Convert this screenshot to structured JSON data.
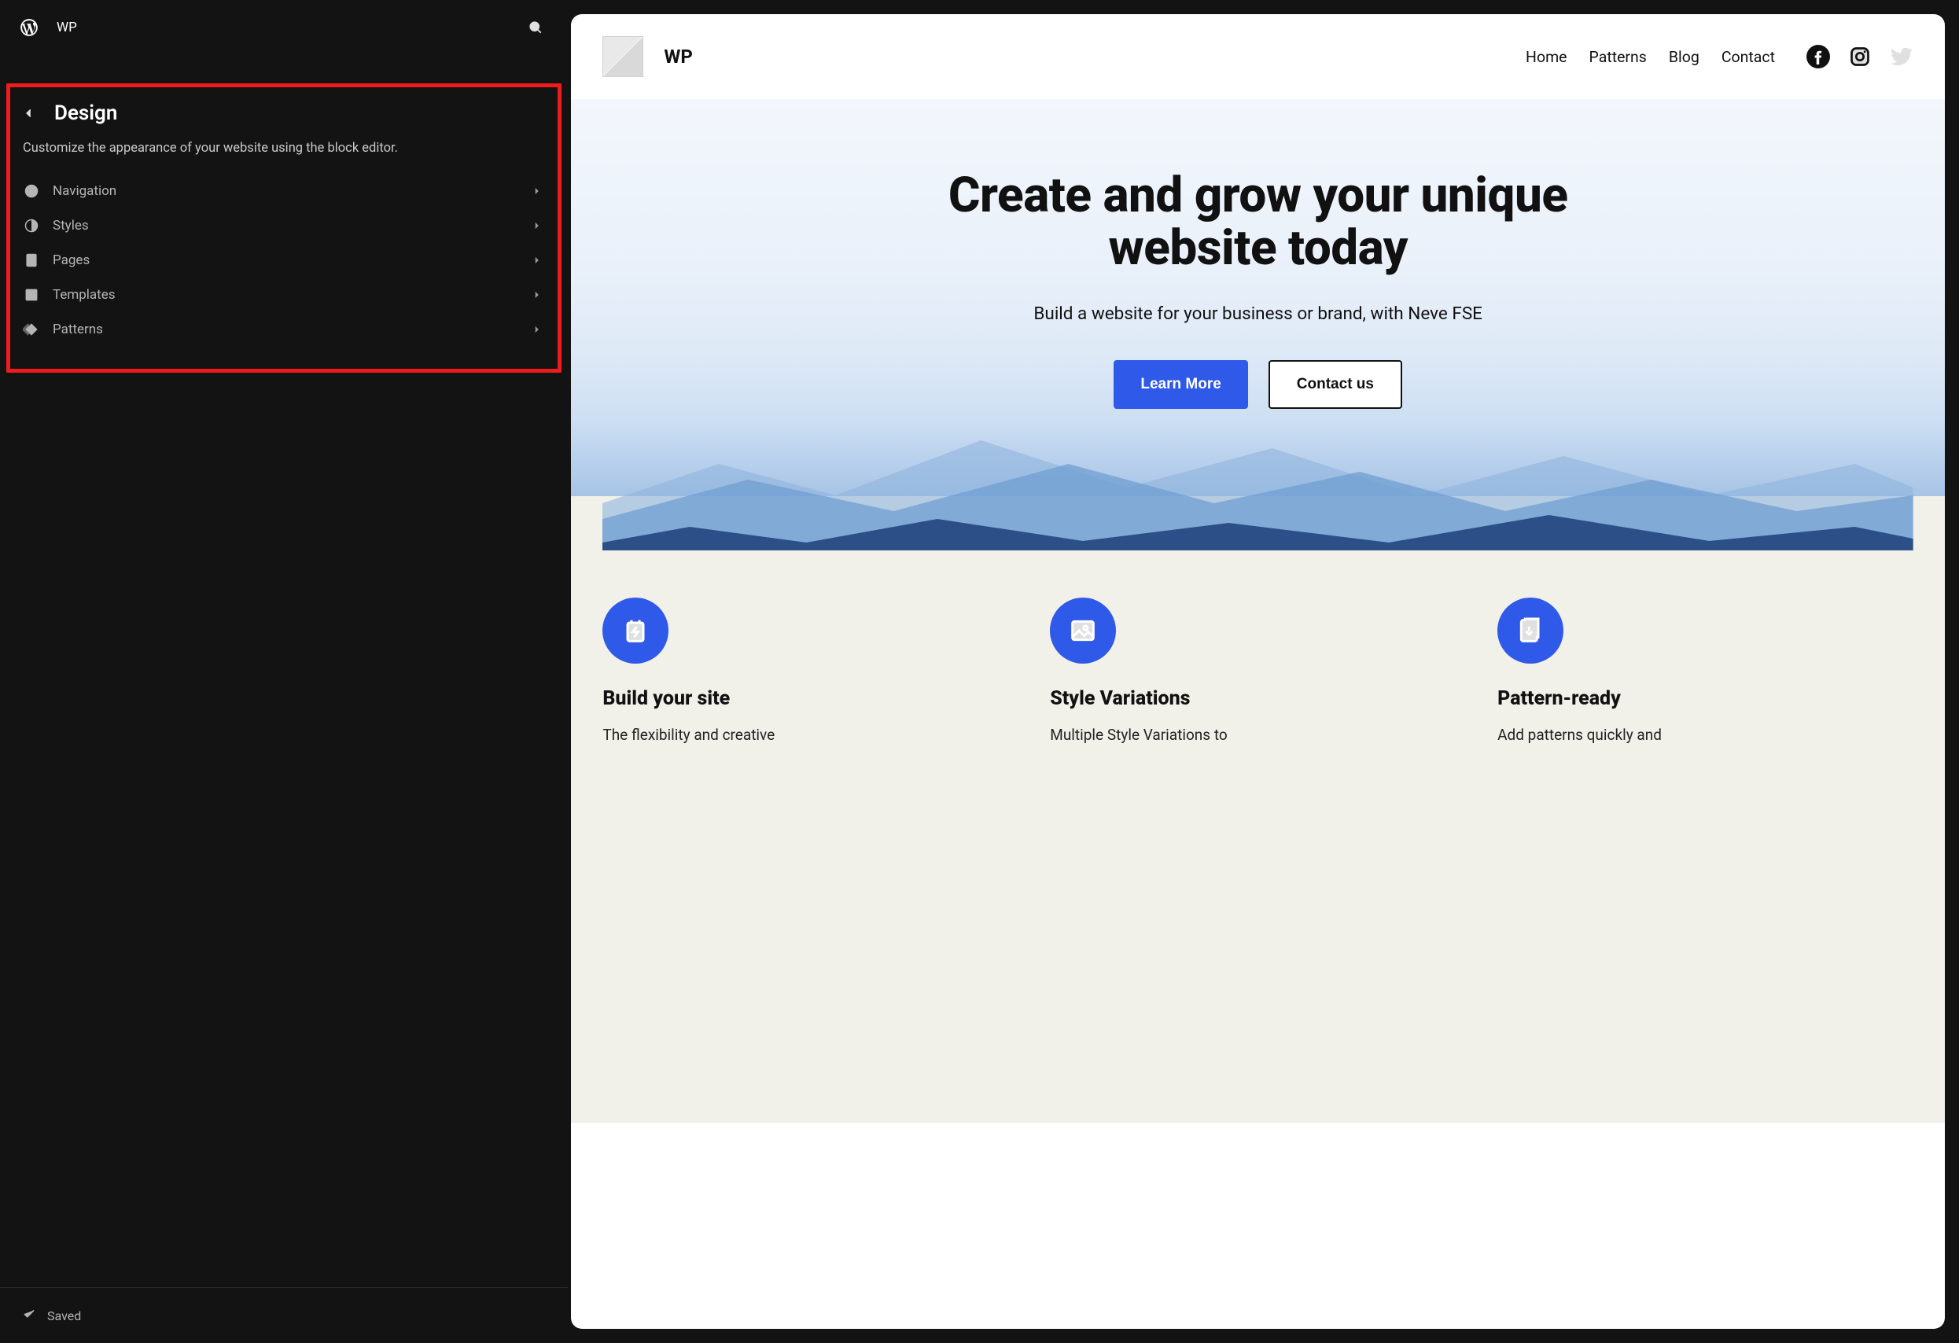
{
  "sidebar": {
    "site_name": "WP",
    "panel_title": "Design",
    "panel_description": "Customize the appearance of your website using the block editor.",
    "items": [
      {
        "label": "Navigation",
        "icon": "compass-icon"
      },
      {
        "label": "Styles",
        "icon": "contrast-icon"
      },
      {
        "label": "Pages",
        "icon": "page-icon"
      },
      {
        "label": "Templates",
        "icon": "layout-icon"
      },
      {
        "label": "Patterns",
        "icon": "diamond-icon"
      }
    ],
    "footer_status": "Saved"
  },
  "preview": {
    "brand_name": "WP",
    "nav": [
      {
        "label": "Home"
      },
      {
        "label": "Patterns"
      },
      {
        "label": "Blog"
      },
      {
        "label": "Contact"
      }
    ],
    "hero": {
      "heading": "Create and grow your unique website today",
      "subheading": "Build a website for your business or brand, with Neve FSE",
      "primary_cta": "Learn More",
      "secondary_cta": "Contact us"
    },
    "features": [
      {
        "title": "Build your site",
        "text": "The flexibility and creative",
        "icon": "battery-icon"
      },
      {
        "title": "Style Variations",
        "text": "Multiple Style Variations to",
        "icon": "image-icon"
      },
      {
        "title": "Pattern-ready",
        "text": "Add patterns quickly and",
        "icon": "download-icon"
      }
    ]
  }
}
